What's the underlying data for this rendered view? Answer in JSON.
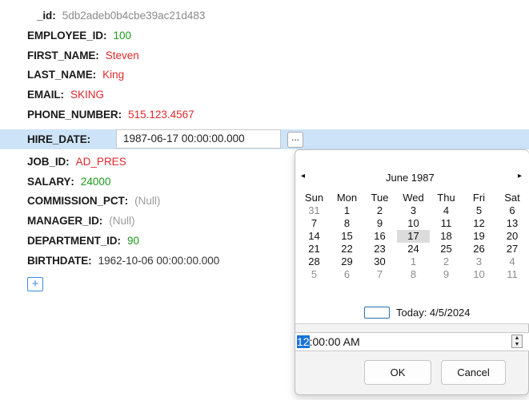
{
  "record": {
    "fields": [
      {
        "key": "_id",
        "value": "5db2adeb0b4cbe39ac21d483",
        "kind": "id"
      },
      {
        "key": "EMPLOYEE_ID",
        "value": "100",
        "kind": "num"
      },
      {
        "key": "FIRST_NAME",
        "value": "Steven",
        "kind": "str"
      },
      {
        "key": "LAST_NAME",
        "value": "King",
        "kind": "str"
      },
      {
        "key": "EMAIL",
        "value": "SKING",
        "kind": "str"
      },
      {
        "key": "PHONE_NUMBER",
        "value": "515.123.4567",
        "kind": "str"
      },
      {
        "key": "HIRE_DATE",
        "value": "1987-06-17 00:00:00.000",
        "kind": "date"
      },
      {
        "key": "JOB_ID",
        "value": "AD_PRES",
        "kind": "str"
      },
      {
        "key": "SALARY",
        "value": "24000",
        "kind": "num"
      },
      {
        "key": "COMMISSION_PCT",
        "value": "(Null)",
        "kind": "null"
      },
      {
        "key": "MANAGER_ID",
        "value": "(Null)",
        "kind": "null"
      },
      {
        "key": "DEPARTMENT_ID",
        "value": "90",
        "kind": "num"
      },
      {
        "key": "BIRTHDATE",
        "value": "1962-10-06 00:00:00.000",
        "kind": "date"
      }
    ],
    "colon": ":",
    "ellipsis_label": "...",
    "add_label": "+"
  },
  "colors": {
    "number": "#1a9b1a",
    "string": "#e0282e",
    "null": "#9a9a9a",
    "selected_row": "#cde3f7",
    "accent": "#1a73d9"
  },
  "calendar": {
    "prev_icon": "◂",
    "next_icon": "▸",
    "month_title": "June 1987",
    "weekdays": [
      "Sun",
      "Mon",
      "Tue",
      "Wed",
      "Thu",
      "Fri",
      "Sat"
    ],
    "weeks": [
      [
        {
          "d": "31",
          "o": true
        },
        {
          "d": "1"
        },
        {
          "d": "2"
        },
        {
          "d": "3"
        },
        {
          "d": "4"
        },
        {
          "d": "5"
        },
        {
          "d": "6"
        }
      ],
      [
        {
          "d": "7"
        },
        {
          "d": "8"
        },
        {
          "d": "9"
        },
        {
          "d": "10"
        },
        {
          "d": "11"
        },
        {
          "d": "12"
        },
        {
          "d": "13"
        }
      ],
      [
        {
          "d": "14"
        },
        {
          "d": "15"
        },
        {
          "d": "16"
        },
        {
          "d": "17",
          "sel": true
        },
        {
          "d": "18"
        },
        {
          "d": "19"
        },
        {
          "d": "20"
        }
      ],
      [
        {
          "d": "21"
        },
        {
          "d": "22"
        },
        {
          "d": "23"
        },
        {
          "d": "24"
        },
        {
          "d": "25"
        },
        {
          "d": "26"
        },
        {
          "d": "27"
        }
      ],
      [
        {
          "d": "28"
        },
        {
          "d": "29"
        },
        {
          "d": "30"
        },
        {
          "d": "1",
          "o": true
        },
        {
          "d": "2",
          "o": true
        },
        {
          "d": "3",
          "o": true
        },
        {
          "d": "4",
          "o": true
        }
      ],
      [
        {
          "d": "5",
          "o": true
        },
        {
          "d": "6",
          "o": true
        },
        {
          "d": "7",
          "o": true
        },
        {
          "d": "8",
          "o": true
        },
        {
          "d": "9",
          "o": true
        },
        {
          "d": "10",
          "o": true
        },
        {
          "d": "11",
          "o": true
        }
      ]
    ],
    "today_label": "Today: 4/5/2024"
  },
  "time": {
    "hour": "12",
    "rest": ":00:00 AM",
    "spin_up": "▲",
    "spin_down": "▼"
  },
  "buttons": {
    "ok": "OK",
    "cancel": "Cancel"
  }
}
